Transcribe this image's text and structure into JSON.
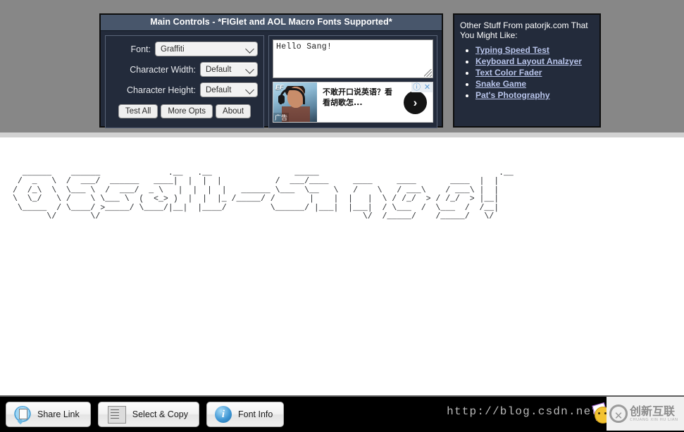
{
  "main_controls": {
    "title": "Main Controls - *FIGlet and AOL Macro Fonts Supported*",
    "font_label": "Font:",
    "font_value": "Graffiti",
    "char_width_label": "Character Width:",
    "char_width_value": "Default",
    "char_height_label": "Character Height:",
    "char_height_value": "Default",
    "buttons": {
      "test_all": "Test All",
      "more_opts": "More Opts",
      "about": "About"
    },
    "input_text": "Hello Sang!"
  },
  "ad": {
    "brand": "EF",
    "label": "广告",
    "line1": "不敢开口说英语？看",
    "line2": "看胡歌怎...",
    "arrow": "›",
    "info_icon": "ⓘ",
    "close_icon": "✕"
  },
  "other_stuff": {
    "title": "Other Stuff From patorjk.com That You Might Like:",
    "links": [
      "Typing Speed Test",
      "Keyboard Layout Analzyer",
      "Text Color Fader",
      "Snake Game",
      "Pat's Photography"
    ]
  },
  "output": {
    "font_name": "Graffiti",
    "rendered_text": "Hello Sang!",
    "ascii_art": "  ______    ______              .__   .__                 _____                                     .__ \n /  _   \\  /  ___/  ______   ____|  |  |  |           /  ___/____     ____     ____       ____  |  |\n/  /_\\  \\  \\___ \\  /  ___/  _ \\   |  |  |  |   ______ \\___  \\__   \\   /    \\   / ___\\    / ___\\ |  |\n\\  \\_/   \\ /    \\ \\___ \\  (  <_> )  |  |  |_ /_____/ /       |    |  |   |  \\ / /_/  > / /_/  > |__|\n \\_____  / \\____/ >_____/ \\____/|__|  |____/         \\______/ |___|  |___|  / \\___  /  \\___  /  /__|\n       \\/       \\/                                                      \\/  /_____/    /_____/   \\/ "
  },
  "toolbar": {
    "share_link": "Share Link",
    "select_copy": "Select & Copy",
    "font_info": "Font Info"
  },
  "watermark": {
    "url": "http://blog.csdn.net/",
    "logo_mark": "✕",
    "logo_cn": "创新互联",
    "logo_pinyin": "CHUANG XIN HU LIAN"
  },
  "colors": {
    "page_background": "#878787",
    "panel_background": "#232b3b",
    "panel_title_bar": "#48566b",
    "panel_border": "#0d0d0d",
    "link": "#b8c4ea",
    "output_background": "#ffffff",
    "bottom_bar": "#000000",
    "ascii_text": "#26292d"
  }
}
